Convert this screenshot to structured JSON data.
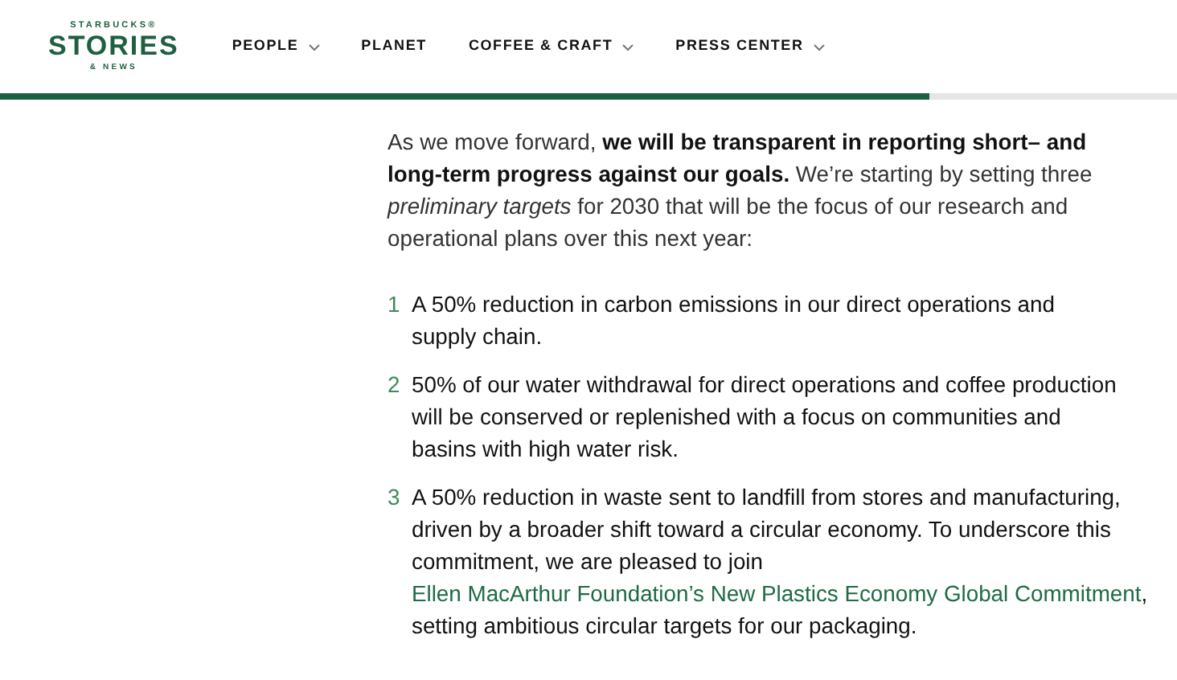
{
  "logo": {
    "top": "STARBUCKS®",
    "main": "STORIES",
    "bottom": "& NEWS"
  },
  "nav": [
    {
      "label": "PEOPLE",
      "dropdown": true
    },
    {
      "label": "PLANET",
      "dropdown": false
    },
    {
      "label": "COFFEE & CRAFT",
      "dropdown": true
    },
    {
      "label": "PRESS CENTER",
      "dropdown": true
    }
  ],
  "reading_progress": {
    "level": 0.79
  },
  "intro": "As we move forward, **we will be transparent in reporting short– and long-term progress against our goals.** We’re starting by setting three *preliminary targets* for 2030 that will be the focus of our research and operational plans over this next year:",
  "targets": [
    {
      "number": "1",
      "parts": [
        {
          "kind": "text",
          "text": "A 50% reduction in carbon emissions in our direct operations and supply chain."
        }
      ]
    },
    {
      "number": "2",
      "parts": [
        {
          "kind": "text",
          "text": "50% of our water withdrawal for direct operations and coffee production will be conserved or replenished with a focus on communities and basins with high water risk."
        }
      ]
    },
    {
      "number": "3",
      "parts": [
        {
          "kind": "text",
          "text": "A 50% reduction in waste sent to landfill from stores and manufacturing, driven by a broader shift toward a circular economy. To underscore this commitment, we are pleased to join "
        },
        {
          "kind": "link",
          "text": "Ellen MacArthur "
        },
        {
          "kind": "link",
          "text": "Foundation’s New Plastics Economy Global Commitment"
        },
        {
          "kind": "text",
          "text": ", setting ambitious circular targets for our packaging."
        }
      ]
    }
  ]
}
